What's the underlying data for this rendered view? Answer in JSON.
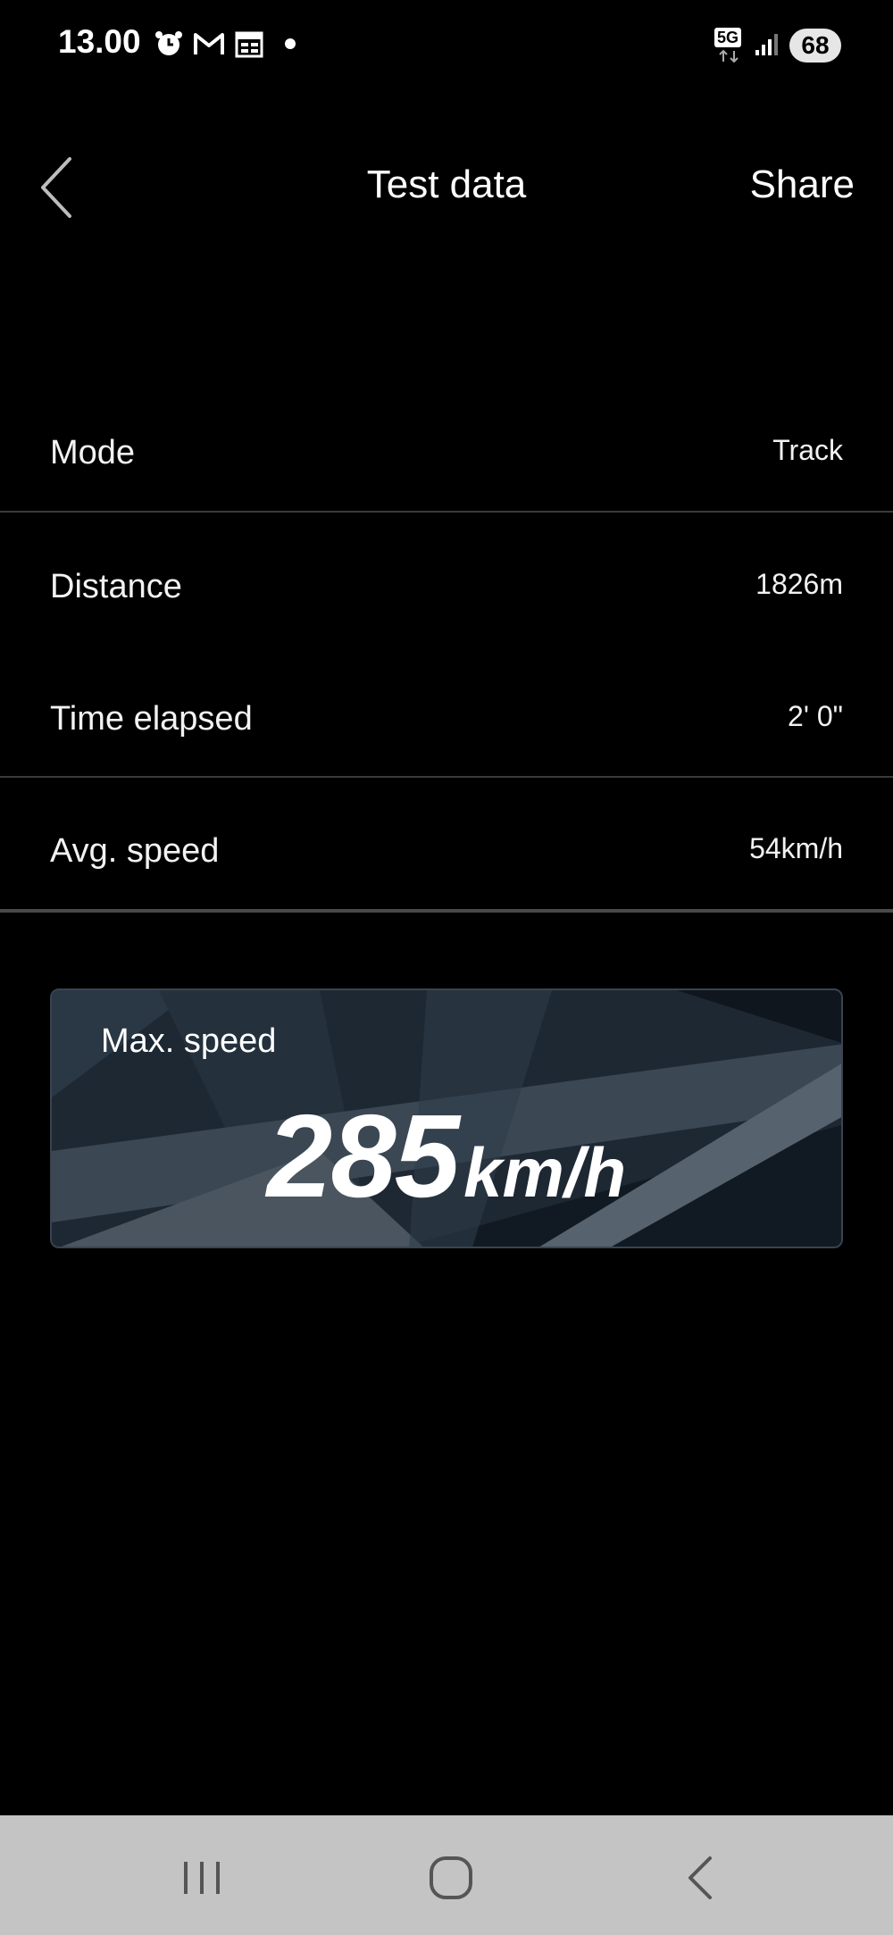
{
  "status_bar": {
    "time": "13.00",
    "network": "5G",
    "battery": "68",
    "icons_left": [
      "alarm-icon",
      "gmail-icon",
      "calendar-icon",
      "dot-icon"
    ],
    "icons_right": [
      "5g-icon",
      "signal-icon",
      "battery-icon"
    ]
  },
  "header": {
    "title": "Test data",
    "share_label": "Share",
    "back_icon": "chevron-left-icon"
  },
  "rows": [
    {
      "label": "Mode",
      "value": "Track"
    },
    {
      "label": "Distance",
      "value": "1826m"
    },
    {
      "label": "Time elapsed",
      "value": "2' 0\""
    },
    {
      "label": "Avg. speed",
      "value": "54km/h"
    }
  ],
  "max_speed": {
    "label": "Max. speed",
    "value": "285",
    "unit": "km/h"
  },
  "nav_bar": {
    "buttons": [
      "recent-apps-icon",
      "home-icon",
      "back-icon"
    ]
  },
  "colors": {
    "background": "#000000",
    "text": "#ffffff",
    "divider": "#3a3a3a",
    "card": "#1c2631",
    "nav_bar": "#c4c4c4"
  }
}
